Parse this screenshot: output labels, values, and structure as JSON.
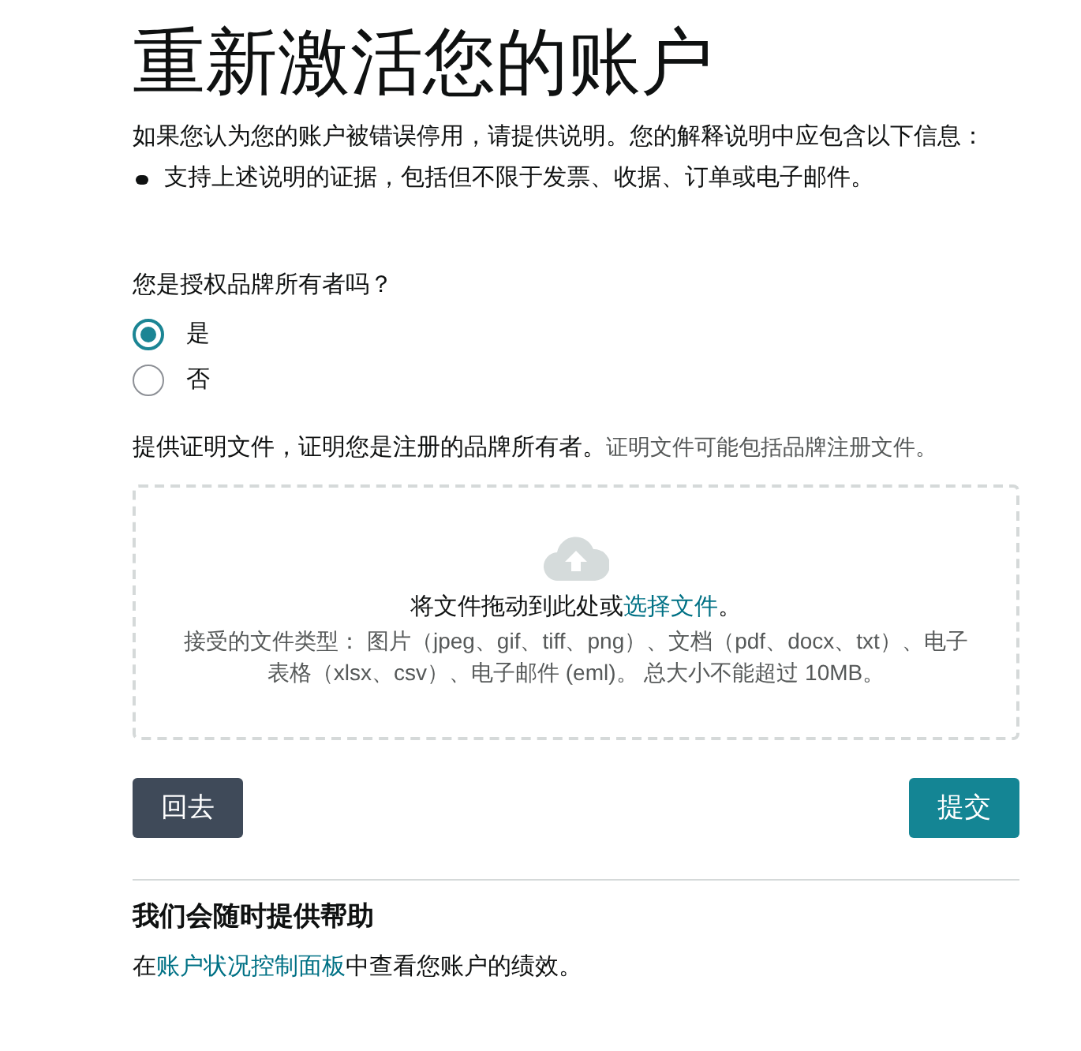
{
  "title": "重新激活您的账户",
  "intro": "如果您认为您的账户被错误停用，请提供说明。您的解释说明中应包含以下信息：",
  "bullets": [
    "支持上述说明的证据，包括但不限于发票、收据、订单或电子邮件。"
  ],
  "question": "您是授权品牌所有者吗？",
  "options": [
    {
      "label": "是",
      "selected": true
    },
    {
      "label": "否",
      "selected": false
    }
  ],
  "proof": {
    "text": "提供证明文件，证明您是注册的品牌所有者。",
    "hint": "证明文件可能包括品牌注册文件。"
  },
  "dropzone": {
    "before": "将文件拖动到此处或",
    "link": "选择文件",
    "after": "。",
    "note": "接受的文件类型： 图片（jpeg、gif、tiff、png）、文档（pdf、docx、txt）、电子表格（xlsx、csv）、电子邮件 (eml)。 总大小不能超过 10MB。"
  },
  "buttons": [
    {
      "label": "回去",
      "kind": "secondary"
    },
    {
      "label": "提交",
      "kind": "primary"
    }
  ],
  "help": {
    "heading": "我们会随时提供帮助",
    "before": "在",
    "link": "账户状况控制面板",
    "after": "中查看您账户的绩效。"
  }
}
